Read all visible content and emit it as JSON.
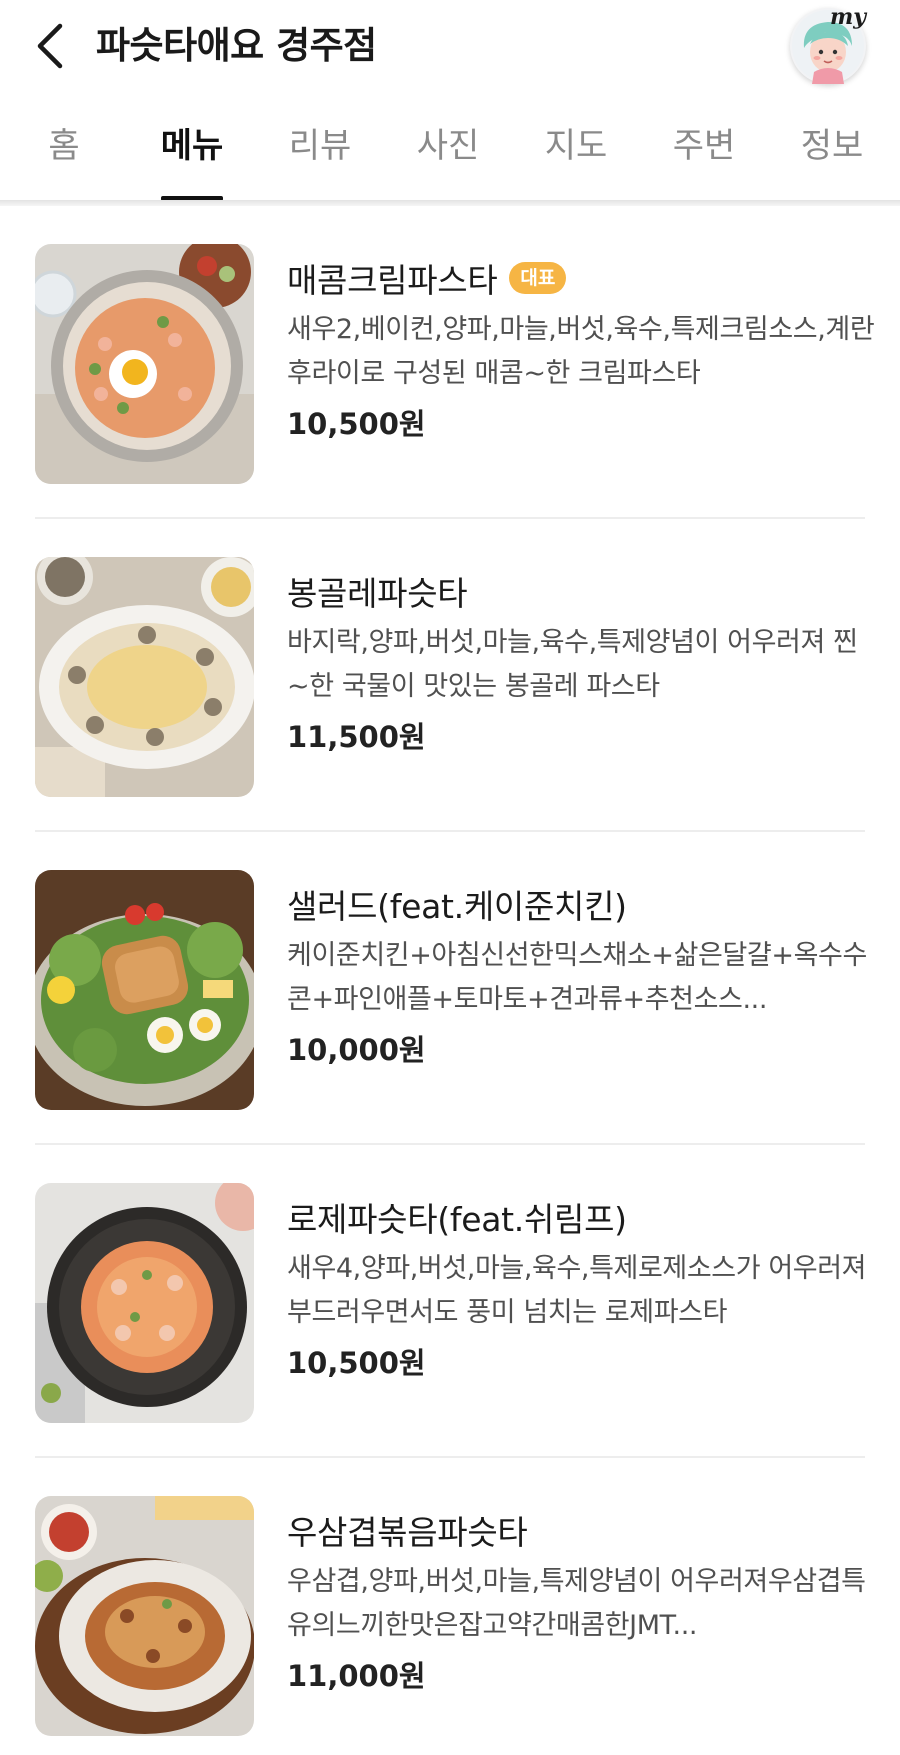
{
  "header": {
    "title": "파슷타애요 경주점",
    "back_icon": "chevron-left-icon",
    "profile_label": "my"
  },
  "tabs": [
    {
      "label": "홈",
      "active": false
    },
    {
      "label": "메뉴",
      "active": true
    },
    {
      "label": "리뷰",
      "active": false
    },
    {
      "label": "사진",
      "active": false
    },
    {
      "label": "지도",
      "active": false
    },
    {
      "label": "주변",
      "active": false
    },
    {
      "label": "정보",
      "active": false
    }
  ],
  "menu": [
    {
      "name": "매콤크림파스타",
      "badge": "대표",
      "description": "새우2,베이컨,양파,마늘,버섯,육수,특제크림소스,계란후라이로 구성된 매콤~한 크림파스타",
      "price": "10,500원"
    },
    {
      "name": "봉골레파슷타",
      "description": "바지락,양파,버섯,마늘,육수,특제양념이 어우러져 찐~한 국물이 맛있는 봉골레 파스타",
      "price": "11,500원"
    },
    {
      "name": "샐러드(feat.케이준치킨)",
      "description": "케이준치킨+아침신선한믹스채소+삶은달걀+옥수수콘+파인애플+토마토+견과류+추천소스...",
      "price": "10,000원"
    },
    {
      "name": "로제파슷타(feat.쉬림프)",
      "description": "새우4,양파,버섯,마늘,육수,특제로제소스가 어우러져 부드러우면서도 풍미 넘치는 로제파스타",
      "price": "10,500원"
    },
    {
      "name": "우삼겹볶음파슷타",
      "description": "우삼겹,양파,버섯,마늘,특제양념이 어우러져우삼겹특유의느끼한맛은잡고약간매콤한JMT...",
      "price": "11,000원"
    }
  ],
  "colors": {
    "badge": "#f6b544",
    "active_tab": "#111111",
    "inactive_tab": "#8a8a8a"
  }
}
